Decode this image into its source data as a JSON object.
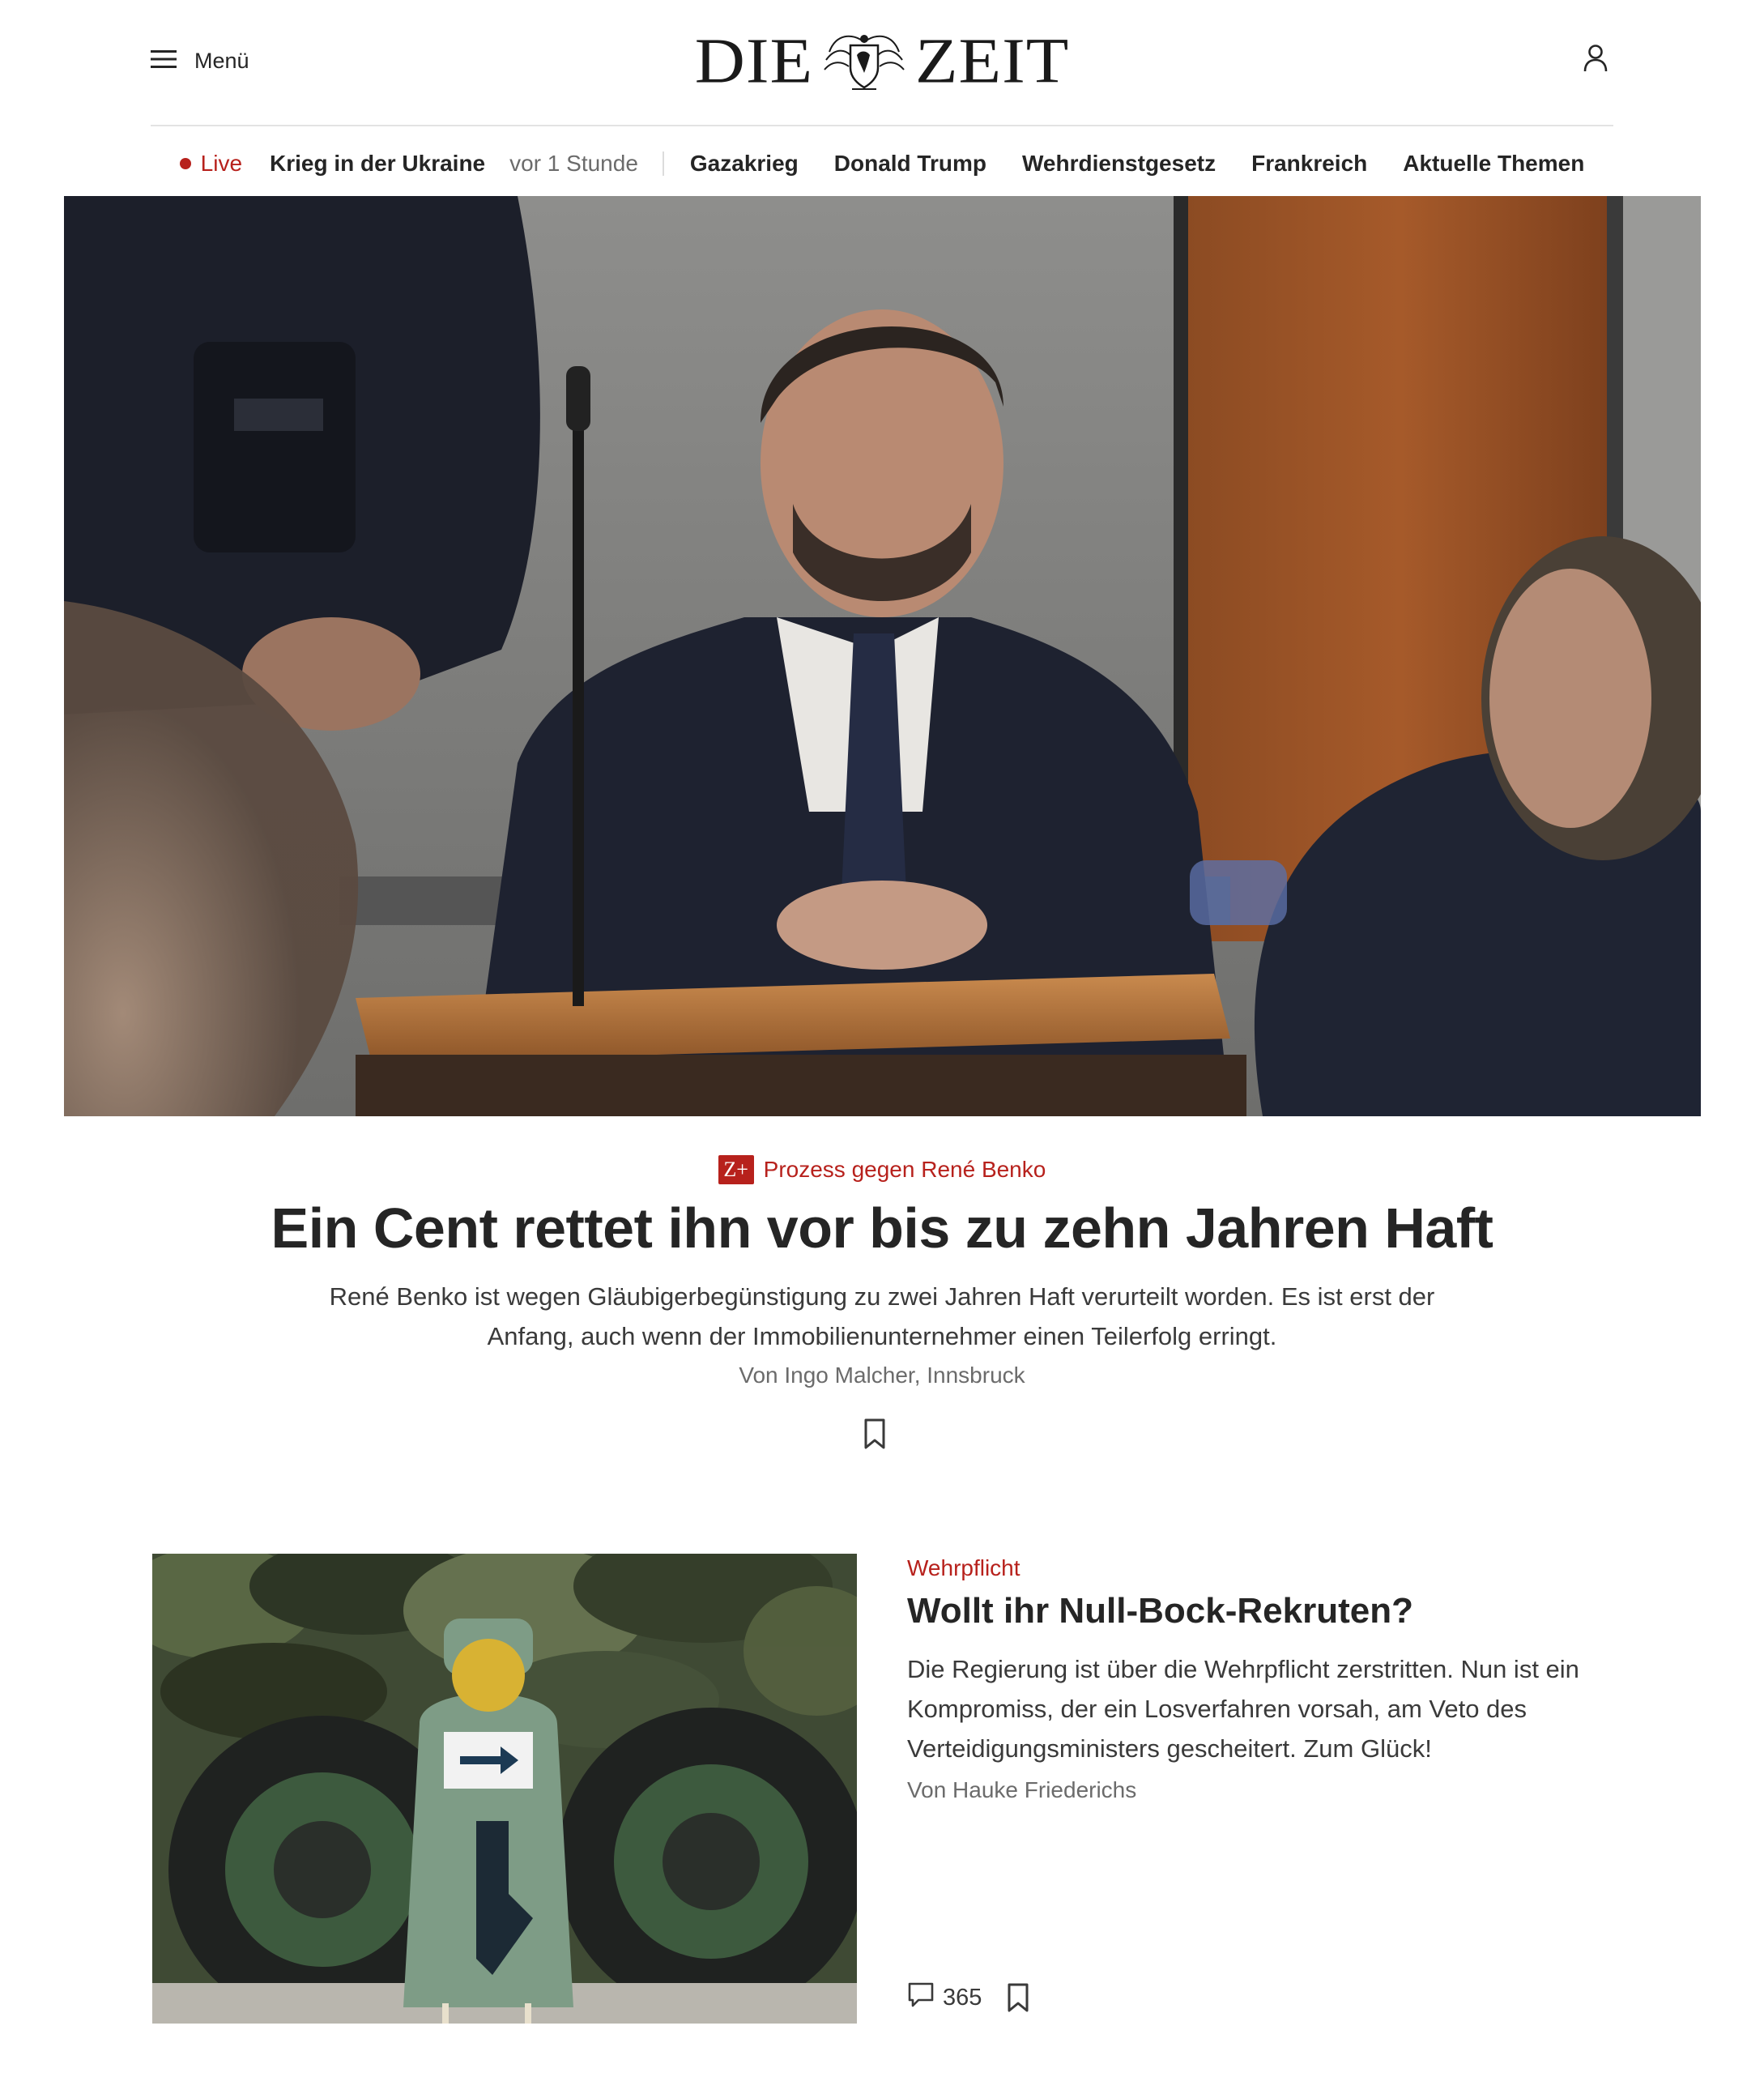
{
  "header": {
    "menu_label": "Menü",
    "logo_left": "DIE",
    "logo_right": "ZEIT",
    "icons": {
      "menu": "hamburger-icon",
      "account": "user-icon",
      "logo_emblem": "eagle-crest-icon"
    }
  },
  "topics": {
    "live_label": "Live",
    "live_topic": "Krieg in der Ukraine",
    "live_time": "vor 1 Stunde",
    "items": [
      "Gazakrieg",
      "Donald Trump",
      "Wehrdienstgesetz",
      "Frankreich",
      "Aktuelle Themen"
    ]
  },
  "hero": {
    "badge": "Z+",
    "kicker": "Prozess gegen René Benko",
    "title": "Ein Cent rettet ihn vor bis zu zehn Jahren Haft",
    "teaser": "René Benko ist wegen Gläubigerbegünstigung zu zwei Jahren Haft verurteilt worden. Es ist erst der Anfang, auch wenn der Immobilienunternehmer einen Teilerfolg erringt.",
    "byline": "Von Ingo Malcher, Innsbruck",
    "bookmark_icon": "bookmark-icon"
  },
  "article2": {
    "kicker": "Wehrpflicht",
    "title": "Wollt ihr Null-Bock-Rekruten?",
    "teaser": "Die Regierung ist über die Wehrpflicht zerstritten. Nun ist ein Kompromiss, der ein Losverfahren vorsah, am Veto des Verteidigungsministers gescheitert. Zum Glück!",
    "byline": "Von Hauke Friederichs",
    "comment_count": "365",
    "comment_icon": "comment-icon",
    "bookmark_icon": "bookmark-icon"
  },
  "colors": {
    "accent": "#b7211c",
    "text": "#252525",
    "muted": "#6b6b6b",
    "divider": "#e3e3e3"
  }
}
